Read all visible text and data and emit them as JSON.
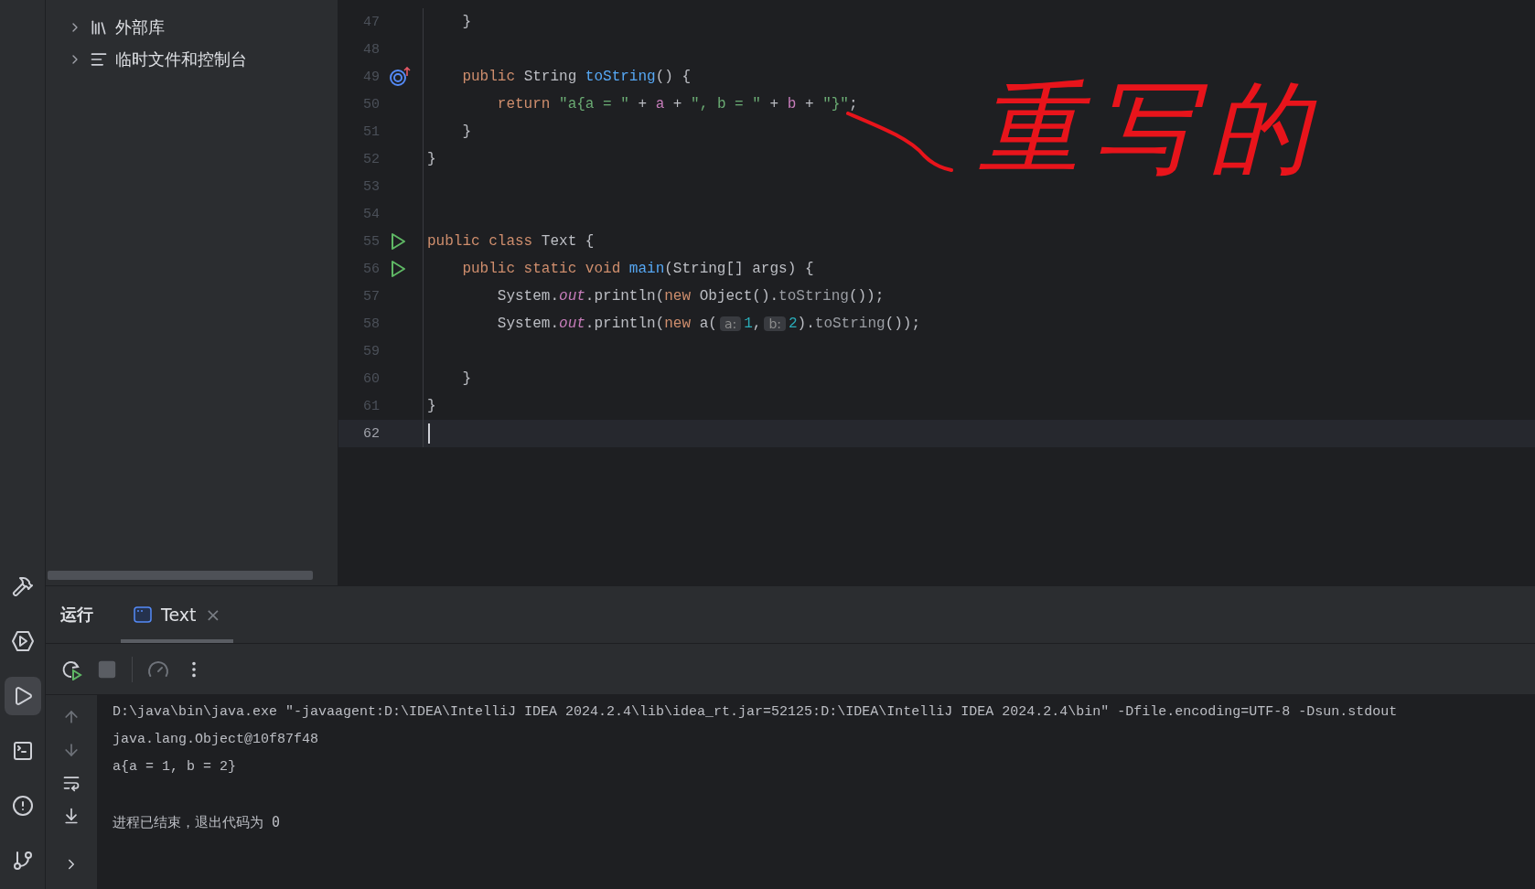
{
  "project_tree": {
    "items": [
      {
        "label": "外部库",
        "kind": "library",
        "expanded": false
      },
      {
        "label": "临时文件和控制台",
        "kind": "scratches",
        "expanded": false
      }
    ]
  },
  "editor": {
    "lines": [
      {
        "number": "47",
        "kind": "plain",
        "current": false,
        "tokens": [
          {
            "kind": "plain",
            "text": "    }"
          }
        ]
      },
      {
        "number": "48",
        "kind": "plain",
        "current": false
      },
      {
        "number": "49",
        "kind": "override",
        "current": false,
        "tokens": [
          {
            "kind": "kw",
            "text": "    public "
          },
          {
            "kind": "plain",
            "text": "String "
          },
          {
            "kind": "decl",
            "text": "toString"
          },
          {
            "kind": "plain",
            "text": "() {"
          }
        ]
      },
      {
        "number": "50",
        "kind": "plain",
        "current": false,
        "tokens": [
          {
            "kind": "kw",
            "text": "        return "
          },
          {
            "kind": "str",
            "text": "\"a{a = \""
          },
          {
            "kind": "plain",
            "text": " + "
          },
          {
            "kind": "field",
            "text": "a"
          },
          {
            "kind": "plain",
            "text": " + "
          },
          {
            "kind": "str",
            "text": "\", b = \""
          },
          {
            "kind": "plain",
            "text": " + "
          },
          {
            "kind": "field",
            "text": "b"
          },
          {
            "kind": "plain",
            "text": " + "
          },
          {
            "kind": "str",
            "text": "\"}\""
          },
          {
            "kind": "plain",
            "text": ";"
          }
        ]
      },
      {
        "number": "51",
        "kind": "plain",
        "current": false,
        "tokens": [
          {
            "kind": "plain",
            "text": "    }"
          }
        ]
      },
      {
        "number": "52",
        "kind": "plain",
        "current": false,
        "tokens": [
          {
            "kind": "plain",
            "text": "}"
          }
        ]
      },
      {
        "number": "53",
        "kind": "plain",
        "current": false
      },
      {
        "number": "54",
        "kind": "plain",
        "current": false
      },
      {
        "number": "55",
        "kind": "run",
        "current": false,
        "tokens": [
          {
            "kind": "kw",
            "text": "public class "
          },
          {
            "kind": "plain",
            "text": "Text {"
          }
        ]
      },
      {
        "number": "56",
        "kind": "run",
        "current": false,
        "tokens": [
          {
            "kind": "kw",
            "text": "    public static void "
          },
          {
            "kind": "decl",
            "text": "main"
          },
          {
            "kind": "plain",
            "text": "(String[] args) {"
          }
        ]
      },
      {
        "number": "57",
        "kind": "plain",
        "current": false,
        "tokens": [
          {
            "kind": "plain",
            "text": "        System."
          },
          {
            "kind": "static",
            "text": "out"
          },
          {
            "kind": "plain",
            "text": ".println("
          },
          {
            "kind": "kw",
            "text": "new "
          },
          {
            "kind": "plain",
            "text": "Object()."
          },
          {
            "kind": "dim",
            "text": "toString"
          },
          {
            "kind": "plain",
            "text": "());"
          }
        ]
      },
      {
        "number": "58",
        "kind": "plain",
        "current": false,
        "tokens": [
          {
            "kind": "plain",
            "text": "        System."
          },
          {
            "kind": "static",
            "text": "out"
          },
          {
            "kind": "plain",
            "text": ".println("
          },
          {
            "kind": "kw",
            "text": "new "
          },
          {
            "kind": "plain",
            "text": "a("
          },
          {
            "kind": "hint",
            "text": "a:"
          },
          {
            "kind": "num",
            "text": "1"
          },
          {
            "kind": "plain",
            "text": ","
          },
          {
            "kind": "hint",
            "text": "b:"
          },
          {
            "kind": "num",
            "text": "2"
          },
          {
            "kind": "plain",
            "text": ")."
          },
          {
            "kind": "dim",
            "text": "toString"
          },
          {
            "kind": "plain",
            "text": "());"
          }
        ]
      },
      {
        "number": "59",
        "kind": "plain",
        "current": false
      },
      {
        "number": "60",
        "kind": "plain",
        "current": false,
        "tokens": [
          {
            "kind": "plain",
            "text": "    }"
          }
        ]
      },
      {
        "number": "61",
        "kind": "plain",
        "current": false,
        "tokens": [
          {
            "kind": "plain",
            "text": "}"
          }
        ]
      },
      {
        "number": "62",
        "kind": "plain",
        "current": true
      }
    ]
  },
  "annotation": {
    "text": "重写的"
  },
  "run_panel": {
    "title": "运行",
    "tabs": [
      {
        "label": "Text",
        "selected": true,
        "close": "×"
      }
    ],
    "console": [
      {
        "kind": "command",
        "text": "D:\\java\\bin\\java.exe \"-javaagent:D:\\IDEA\\IntelliJ IDEA 2024.2.4\\lib\\idea_rt.jar=52125:D:\\IDEA\\IntelliJ IDEA 2024.2.4\\bin\" -Dfile.encoding=UTF-8 -Dsun.stdout"
      },
      {
        "kind": "output",
        "text": "java.lang.Object@10f87f48"
      },
      {
        "kind": "output",
        "text": "a{a = 1, b = 2}"
      },
      {
        "kind": "blank"
      },
      {
        "kind": "status",
        "text": "进程已结束，退出代码为 0"
      }
    ]
  }
}
